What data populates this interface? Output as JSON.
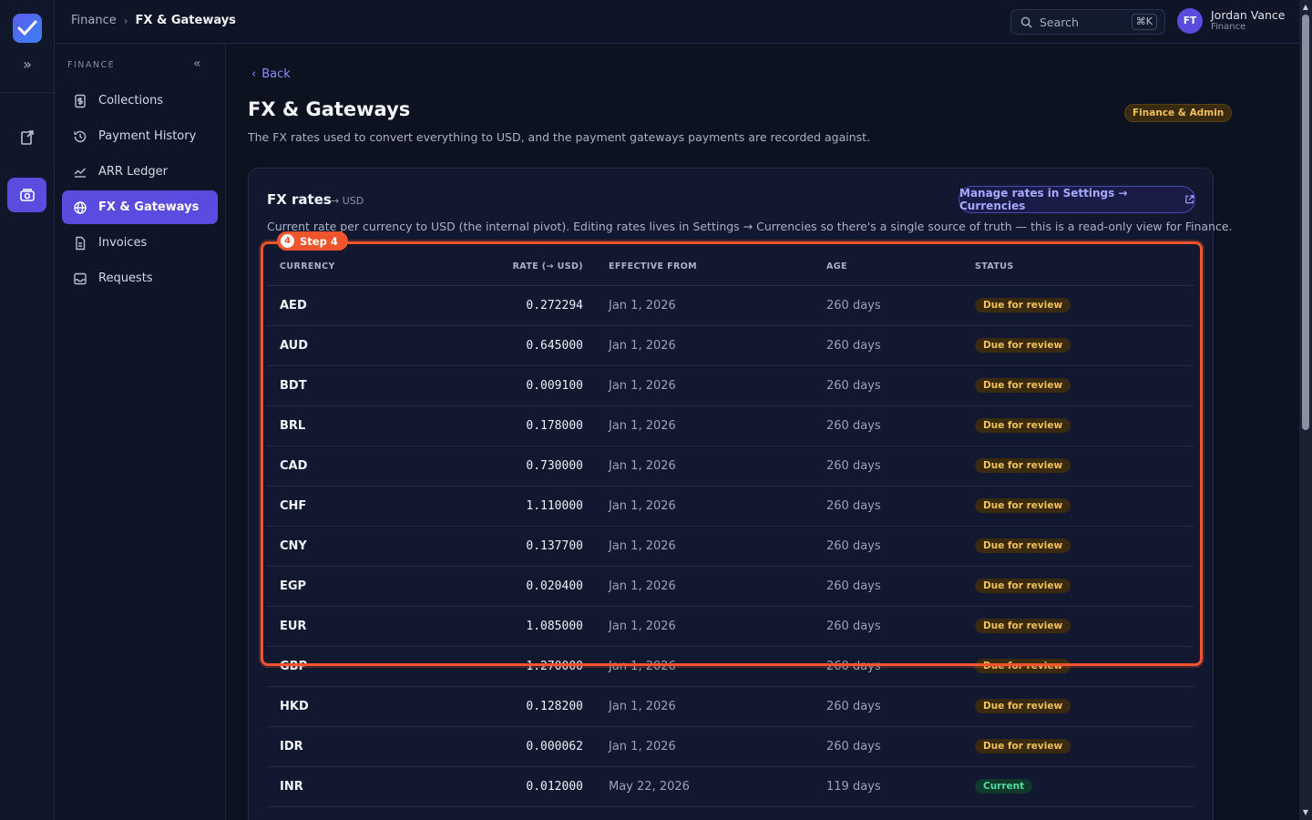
{
  "breadcrumb": {
    "parent": "Finance",
    "current": "FX & Gateways"
  },
  "search": {
    "placeholder": "Search",
    "shortcut": "⌘K"
  },
  "user": {
    "initials": "FT",
    "name": "Jordan Vance",
    "role": "Finance"
  },
  "sidebar": {
    "section_title": "FINANCE",
    "items": [
      {
        "label": "Collections",
        "icon": "dollar-doc-icon"
      },
      {
        "label": "Payment History",
        "icon": "history-icon"
      },
      {
        "label": "ARR Ledger",
        "icon": "chart-line-icon"
      },
      {
        "label": "FX & Gateways",
        "icon": "globe-icon",
        "active": true
      },
      {
        "label": "Invoices",
        "icon": "document-icon"
      },
      {
        "label": "Requests",
        "icon": "inbox-icon"
      }
    ]
  },
  "page": {
    "back_label": "Back",
    "title": "FX & Gateways",
    "description": "The FX rates used to convert everything to USD, and the payment gateways payments are recorded against.",
    "role_badge": "Finance & Admin"
  },
  "fx_card": {
    "title": "FX rates",
    "subtitle": "→ USD",
    "manage_button": "Manage rates in Settings → Currencies",
    "description": "Current rate per currency to USD (the internal pivot). Editing rates lives in Settings → Currencies so there's a single source of truth — this is a read-only view for Finance.",
    "columns": [
      "CURRENCY",
      "RATE (→ USD)",
      "EFFECTIVE FROM",
      "AGE",
      "STATUS"
    ],
    "rows": [
      {
        "currency": "AED",
        "rate": "0.272294",
        "effective": "Jan 1, 2026",
        "age": "260 days",
        "status": "Due for review"
      },
      {
        "currency": "AUD",
        "rate": "0.645000",
        "effective": "Jan 1, 2026",
        "age": "260 days",
        "status": "Due for review"
      },
      {
        "currency": "BDT",
        "rate": "0.009100",
        "effective": "Jan 1, 2026",
        "age": "260 days",
        "status": "Due for review"
      },
      {
        "currency": "BRL",
        "rate": "0.178000",
        "effective": "Jan 1, 2026",
        "age": "260 days",
        "status": "Due for review"
      },
      {
        "currency": "CAD",
        "rate": "0.730000",
        "effective": "Jan 1, 2026",
        "age": "260 days",
        "status": "Due for review"
      },
      {
        "currency": "CHF",
        "rate": "1.110000",
        "effective": "Jan 1, 2026",
        "age": "260 days",
        "status": "Due for review"
      },
      {
        "currency": "CNY",
        "rate": "0.137700",
        "effective": "Jan 1, 2026",
        "age": "260 days",
        "status": "Due for review"
      },
      {
        "currency": "EGP",
        "rate": "0.020400",
        "effective": "Jan 1, 2026",
        "age": "260 days",
        "status": "Due for review"
      },
      {
        "currency": "EUR",
        "rate": "1.085000",
        "effective": "Jan 1, 2026",
        "age": "260 days",
        "status": "Due for review"
      },
      {
        "currency": "GBP",
        "rate": "1.270000",
        "effective": "Jan 1, 2026",
        "age": "260 days",
        "status": "Due for review"
      },
      {
        "currency": "HKD",
        "rate": "0.128200",
        "effective": "Jan 1, 2026",
        "age": "260 days",
        "status": "Due for review"
      },
      {
        "currency": "IDR",
        "rate": "0.000062",
        "effective": "Jan 1, 2026",
        "age": "260 days",
        "status": "Due for review"
      },
      {
        "currency": "INR",
        "rate": "0.012000",
        "effective": "May 22, 2026",
        "age": "119 days",
        "status": "Current"
      }
    ]
  },
  "tour": {
    "step_number": "4",
    "step_label": "Step 4"
  },
  "colors": {
    "accent": "#5b4ce0",
    "highlight": "#f2542d",
    "review": "#f0c05a",
    "current": "#4fdca0"
  }
}
